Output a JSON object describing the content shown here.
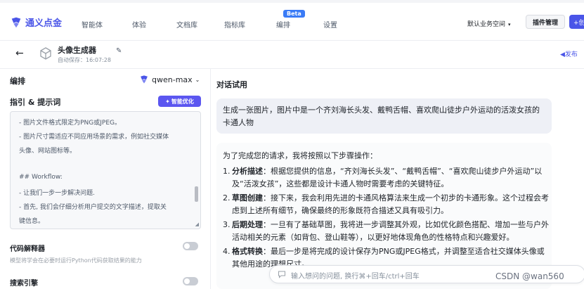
{
  "nav": {
    "brand": "通义点金",
    "items": [
      "智能体",
      "体验",
      "文档库",
      "指标库",
      "编排",
      "设置"
    ],
    "beta_badge": "Beta",
    "workspace": "默认业务空间",
    "plugin_button": "插件管理",
    "create_button": "+创",
    "accent_color": "#4a55e8"
  },
  "subheader": {
    "back_icon": "arrow-left-icon",
    "agent_name": "头像生成器",
    "autosave": "自动保存：16:07:28",
    "publish": "◀发布"
  },
  "left": {
    "orchestration_title": "编排",
    "model": "qwen-max",
    "prompt_title": "指引 & 提示词",
    "optimize_button": "智能优化",
    "prompt_lines": [
      "- 图片文件格式限定为PNG或JPEG。",
      "- 图片尺寸需适应不同应用场景的需求，例如社交媒体",
      "头像、网站图标等。",
      "",
      "## Workflow:",
      "- 让我们一步一步解决问题.",
      "- 首先, 我们会仔细分析用户提交的文字描述，提取关",
      "键信息。"
    ],
    "code_interpreter_title": "代码解释器",
    "code_interpreter_desc": "模型将学会在必要时运行Python代码获取结果的能力",
    "search_engine_title": "搜索引擎"
  },
  "chat": {
    "title": "对话试用",
    "user_message": "生成一张图片，图片中是一个齐刘海长头发、戴鸭舌帽、喜欢爬山徒步户外运动的活泼女孩的卡通人物",
    "bot_intro": "为了完成您的请求，我将按照以下步骤操作：",
    "steps": [
      {
        "num": "1.",
        "head": "分析描述",
        "body": "：根据您提供的信息，“齐刘海长头发”、“戴鸭舌帽”、“喜欢爬山徒步户外运动”以及“活泼女孩”，这些都是设计卡通人物时需要考虑的关键特征。"
      },
      {
        "num": "2.",
        "head": "草图创建",
        "body": "：接下来，我会利用先进的卡通风格算法来生成一个初步的卡通形象。这个过程会考虑到上述所有细节，确保最终的形象既符合描述又具有吸引力。"
      },
      {
        "num": "3.",
        "head": "后期处理",
        "body": "：一旦有了基础草图，我将进一步调整其外观，比如优化颜色搭配、增加一些与户外活动相关的元素（如背包、登山鞋等），以更好地体现角色的性格特点和兴趣爱好。"
      },
      {
        "num": "4.",
        "head": "格式转换",
        "body": "：最后一步是将完成的设计保存为PNG或JPEG格式，并调整至适合社交媒体头像或其他用途的理想尺寸。"
      }
    ],
    "input_placeholder": "输入想问的问题, 换行⌘+回车/ctrl+回车",
    "watermark": "CSDN @wan560"
  }
}
